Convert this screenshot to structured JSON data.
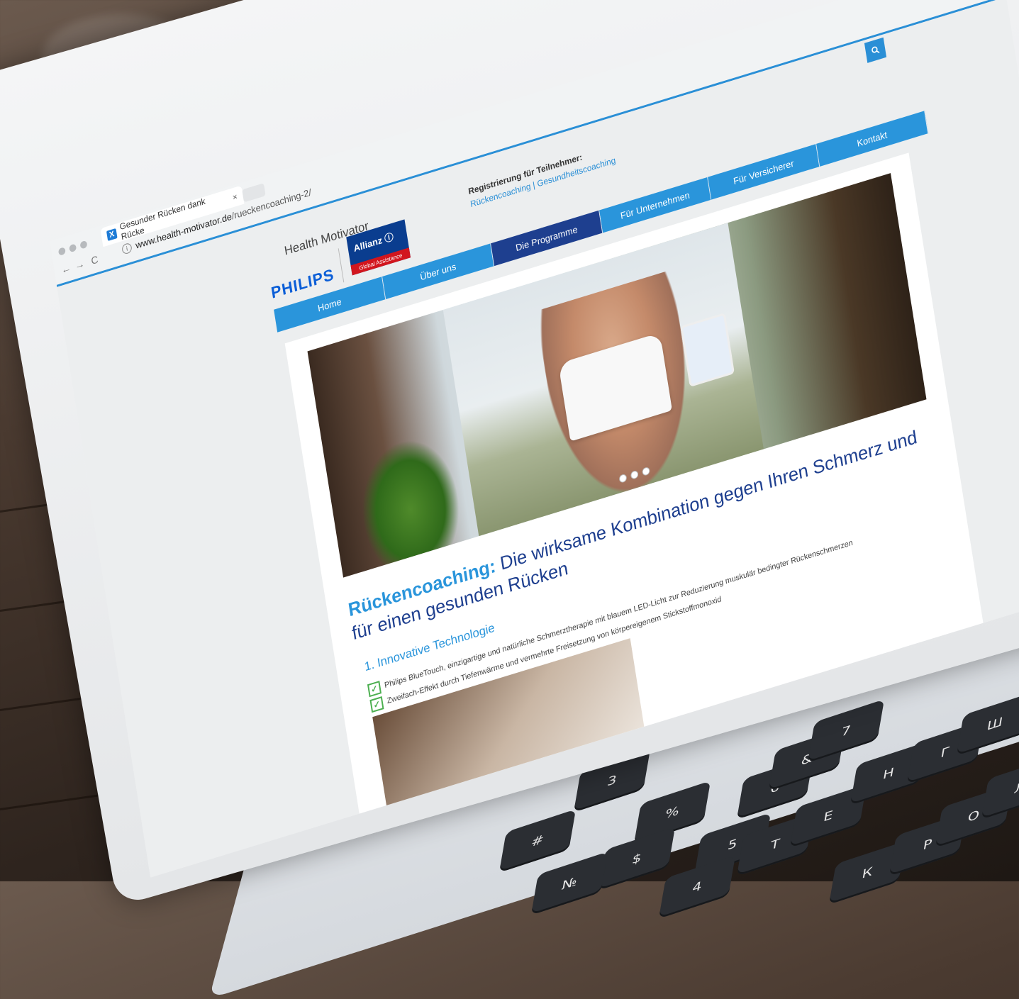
{
  "browser": {
    "tab_title": "Gesunder Rücken dank Rücke",
    "tab_close": "×",
    "favicon": "X",
    "back": "←",
    "forward": "→",
    "reload": "C",
    "info": "i",
    "url_host": "www.health-motivator.de",
    "url_path": "/rueckencoaching-2/",
    "accent": "#2a8fd6"
  },
  "header": {
    "philips": "PHILIPS",
    "health_motivator": "Health Motivator",
    "allianz_name": "Allianz ⓘ",
    "allianz_sub": "Global Assistance",
    "registration_title": "Registrierung für Teilnehmer:",
    "registration_links": "Rückencoaching | Gesundheitscoaching",
    "search_icon": "search-icon"
  },
  "nav": {
    "items": [
      {
        "label": "Home"
      },
      {
        "label": "Über uns"
      },
      {
        "label": "Die Programme"
      },
      {
        "label": "Für Unternehmen"
      },
      {
        "label": "Für Versicherer"
      },
      {
        "label": "Kontakt"
      }
    ],
    "active_index": 2
  },
  "main": {
    "headline_lead": "Rückencoaching:",
    "headline_rest": "Die wirksame Kombination gegen Ihren Schmerz und für einen gesunden Rücken",
    "subhead": "1. Innovative Technologie",
    "checks": [
      "Philips BlueTouch, einzigartige und natürliche Schmerztherapie mit blauem LED-Licht zur Reduzierung muskulär bedingter Rückenschmerzen",
      "Zweifach-Effekt durch Tiefenwärme und vermehrte Freisetzung von körpereigenem Stickstoffmonoxid"
    ],
    "carousel_dots": 3
  },
  "keyboard": {
    "keys": [
      "%",
      "5",
      "$",
      "4",
      "№",
      "#",
      "3",
      "6",
      "&",
      "7",
      "Т",
      "Е",
      "К",
      "Р",
      "Н",
      "Г",
      "Ш",
      "О",
      "Л"
    ]
  }
}
